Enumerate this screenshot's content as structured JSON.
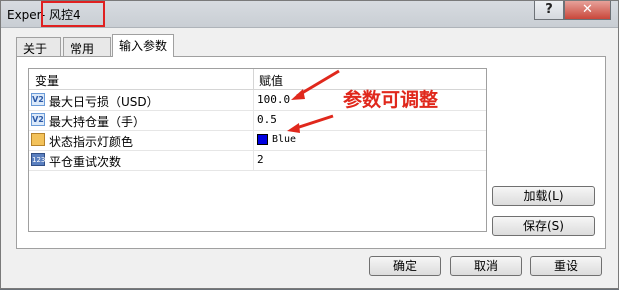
{
  "window": {
    "title_prefix": "Exper",
    "title_name": "- 风控4",
    "help_label": "?",
    "close_label": "✕"
  },
  "tabs": [
    {
      "label": "关于"
    },
    {
      "label": "常用"
    },
    {
      "label": "输入参数",
      "active": true
    }
  ],
  "grid": {
    "columns": [
      "变量",
      "赋值"
    ],
    "rows": [
      {
        "name": "最大日亏损（USD）",
        "value": "100.0",
        "icon": "v2-icon"
      },
      {
        "name": "最大持仓量（手）",
        "value": "0.5",
        "icon": "v2-icon"
      },
      {
        "name": "状态指示灯颜色",
        "value": "Blue",
        "icon": "color-icon",
        "color": "#0000e0"
      },
      {
        "name": "平仓重试次数",
        "value": "2",
        "icon": "number-icon"
      }
    ]
  },
  "side_buttons": {
    "load": "加载(L)",
    "save": "保存(S)"
  },
  "footer_buttons": {
    "ok": "确定",
    "cancel": "取消",
    "reset": "重设"
  },
  "annotation": {
    "text": "参数可调整",
    "color": "#e0281c"
  }
}
